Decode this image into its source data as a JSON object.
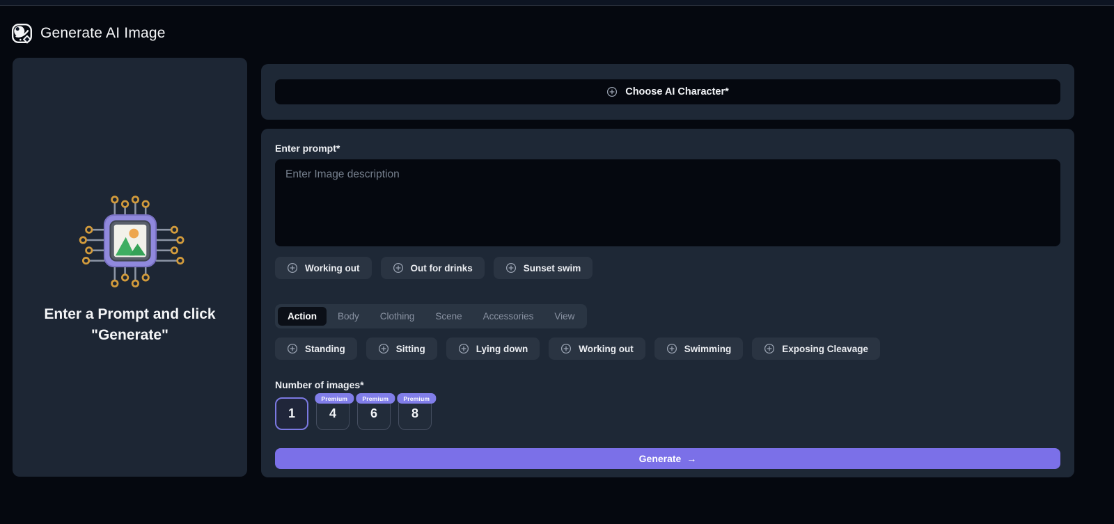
{
  "header": {
    "title": "Generate AI Image",
    "logo_icon": "ai-image-logo"
  },
  "left_panel": {
    "message": "Enter a Prompt and click \"Generate\"",
    "illustration": "chip-image-illustration"
  },
  "character": {
    "button_label": "Choose AI Character*",
    "icon": "plus-circle-icon"
  },
  "prompt": {
    "label": "Enter prompt*",
    "placeholder": "Enter Image description"
  },
  "suggestions": [
    "Working out",
    "Out for drinks",
    "Sunset swim"
  ],
  "tabs": {
    "items": [
      "Action",
      "Body",
      "Clothing",
      "Scene",
      "Accessories",
      "View"
    ],
    "active": "Action"
  },
  "action_chips": [
    "Standing",
    "Sitting",
    "Lying down",
    "Working out",
    "Swimming",
    "Exposing Cleavage"
  ],
  "images": {
    "label": "Number of images*",
    "premium_badge": "Premium",
    "options": [
      {
        "value": "1",
        "premium": false,
        "selected": true
      },
      {
        "value": "4",
        "premium": true,
        "selected": false
      },
      {
        "value": "6",
        "premium": true,
        "selected": false
      },
      {
        "value": "8",
        "premium": true,
        "selected": false
      }
    ]
  },
  "generate": {
    "label": "Generate",
    "arrow": "→"
  },
  "colors": {
    "page_bg": "#05080f",
    "panel": "#1e2836",
    "chip": "#2a3442",
    "accent": "#7b70e8",
    "premium_badge": "#817ee9",
    "selected_border": "#7b79e2",
    "terminal_gold": "#d29b3c",
    "chip_purple": "#9089dd"
  }
}
